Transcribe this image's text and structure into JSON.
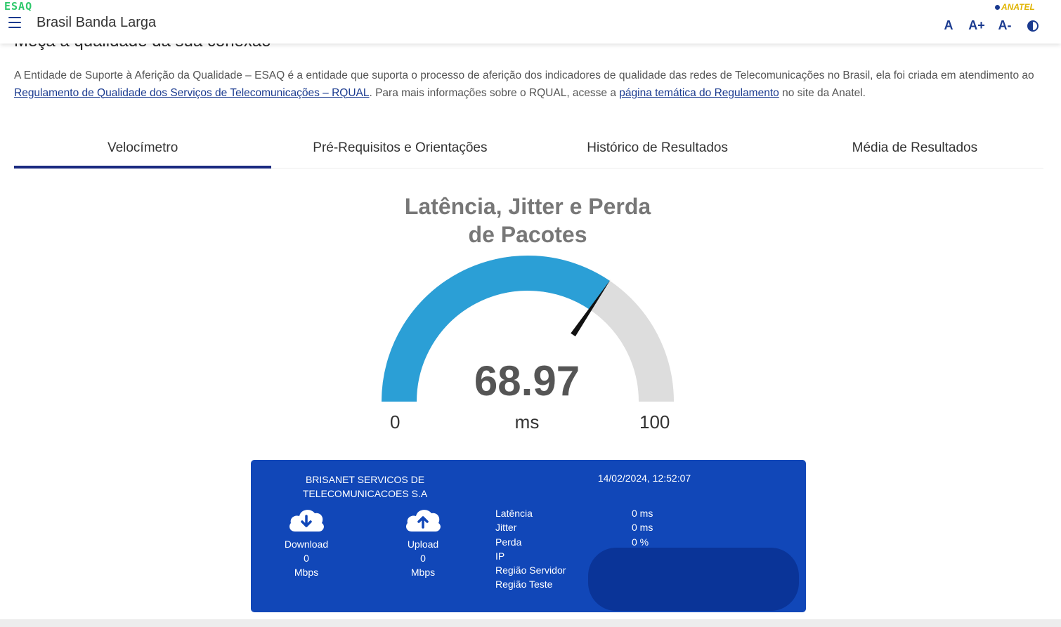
{
  "header": {
    "logo": "ESAQ",
    "app_title": "Brasil Banda Larga",
    "anatel_logo": "ANATEL",
    "font_controls": [
      "A",
      "A+",
      "A-"
    ]
  },
  "page": {
    "heading": "Meça a qualidade da sua conexão",
    "intro_part1": "A Entidade de Suporte à Aferição da Qualidade – ESAQ é a entidade que suporta o processo de aferição dos indicadores de qualidade das redes de Telecomunicações no Brasil, ela foi criada em atendimento ao ",
    "intro_link1": "Regulamento de Qualidade dos Serviços de Telecomunicações – RQUAL",
    "intro_part2": ". Para mais informações sobre o RQUAL, acesse a ",
    "intro_link2": "página temática do Regulamento",
    "intro_part3": " no site da Anatel."
  },
  "tabs": [
    {
      "label": "Velocímetro",
      "active": true
    },
    {
      "label": "Pré-Requisitos e Orientações",
      "active": false
    },
    {
      "label": "Histórico de Resultados",
      "active": false
    },
    {
      "label": "Média de Resultados",
      "active": false
    }
  ],
  "gauge": {
    "title_line1": "Latência, Jitter e Perda",
    "title_line2": "de Pacotes",
    "value": "68.97",
    "value_num": 68.97,
    "min": "0",
    "max": "100",
    "min_num": 0,
    "max_num": 100,
    "unit": "ms",
    "fill_color": "#2b9fd6",
    "track_color": "#dddddd"
  },
  "result": {
    "provider_line1": "BRISANET SERVICOS DE",
    "provider_line2": "TELECOMUNICACOES S.A",
    "datetime": "14/02/2024, 12:52:07",
    "download": {
      "label": "Download",
      "value": "0",
      "unit": "Mbps"
    },
    "upload": {
      "label": "Upload",
      "value": "0",
      "unit": "Mbps"
    },
    "details": [
      {
        "key": "Latência",
        "value": "0 ms"
      },
      {
        "key": "Jitter",
        "value": "0 ms"
      },
      {
        "key": "Perda",
        "value": "0 %"
      },
      {
        "key": "IP",
        "value": ""
      },
      {
        "key": "Região Servidor",
        "value": ""
      },
      {
        "key": "Região Teste",
        "value": ""
      }
    ],
    "card_color": "#1147b8"
  }
}
